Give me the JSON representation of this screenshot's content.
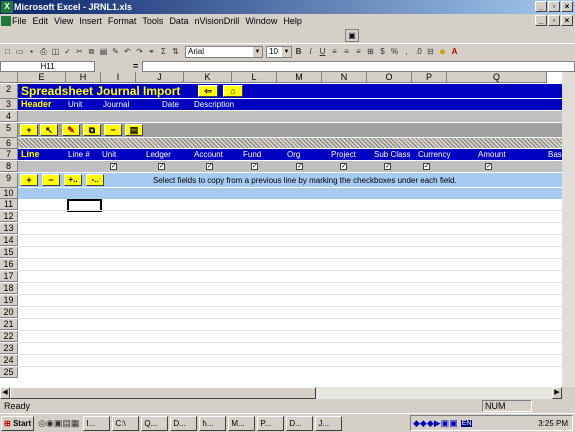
{
  "window": {
    "title": "Microsoft Excel - JRNL1.xls",
    "app_icon": "excel-icon"
  },
  "menu": [
    "File",
    "Edit",
    "View",
    "Insert",
    "Format",
    "Tools",
    "Data",
    "nVisionDrill",
    "Window",
    "Help"
  ],
  "toolbar": {
    "font": "Arial",
    "size": "10"
  },
  "formula": {
    "namebox": "H11",
    "eq": "="
  },
  "columns": [
    "E",
    "H",
    "I",
    "J",
    "K",
    "L",
    "M",
    "N",
    "O",
    "P",
    "Q"
  ],
  "rows": [
    "2",
    "3",
    "4",
    "5",
    "6",
    "7",
    "8",
    "9",
    "10",
    "11",
    "12",
    "13",
    "14",
    "15",
    "16",
    "17",
    "18",
    "19",
    "20",
    "21",
    "22",
    "23",
    "24",
    "25"
  ],
  "sheet": {
    "title": "Spreadsheet Journal Import",
    "header_label": "Header",
    "header_cols": [
      "Unit",
      "Journal",
      "Date",
      "Description"
    ],
    "line_label": "Line",
    "line_cols": [
      "Line #",
      "Unit",
      "Ledger",
      "Account",
      "Fund",
      "Org",
      "Project",
      "Sub Class",
      "Currency",
      "Amount",
      "Base"
    ],
    "row5_buttons": [
      "+",
      "↖",
      "✎",
      "⧉",
      "−",
      "▤"
    ],
    "row9_buttons": [
      "+",
      "−",
      "+..",
      "-.."
    ],
    "row9_text": "Select fields to copy from a previous line by marking the checkboxes under each field.",
    "title_buttons": [
      "⇦",
      "⌂"
    ]
  },
  "status": {
    "text": "Ready",
    "num": "NUM"
  },
  "taskbar": {
    "start": "Start",
    "items": [
      "I...",
      "C:\\",
      "Q...",
      "D...",
      "h...",
      "M...",
      "P...",
      "D...",
      "J..."
    ],
    "lang": "EN",
    "clock": "3:25 PM"
  }
}
